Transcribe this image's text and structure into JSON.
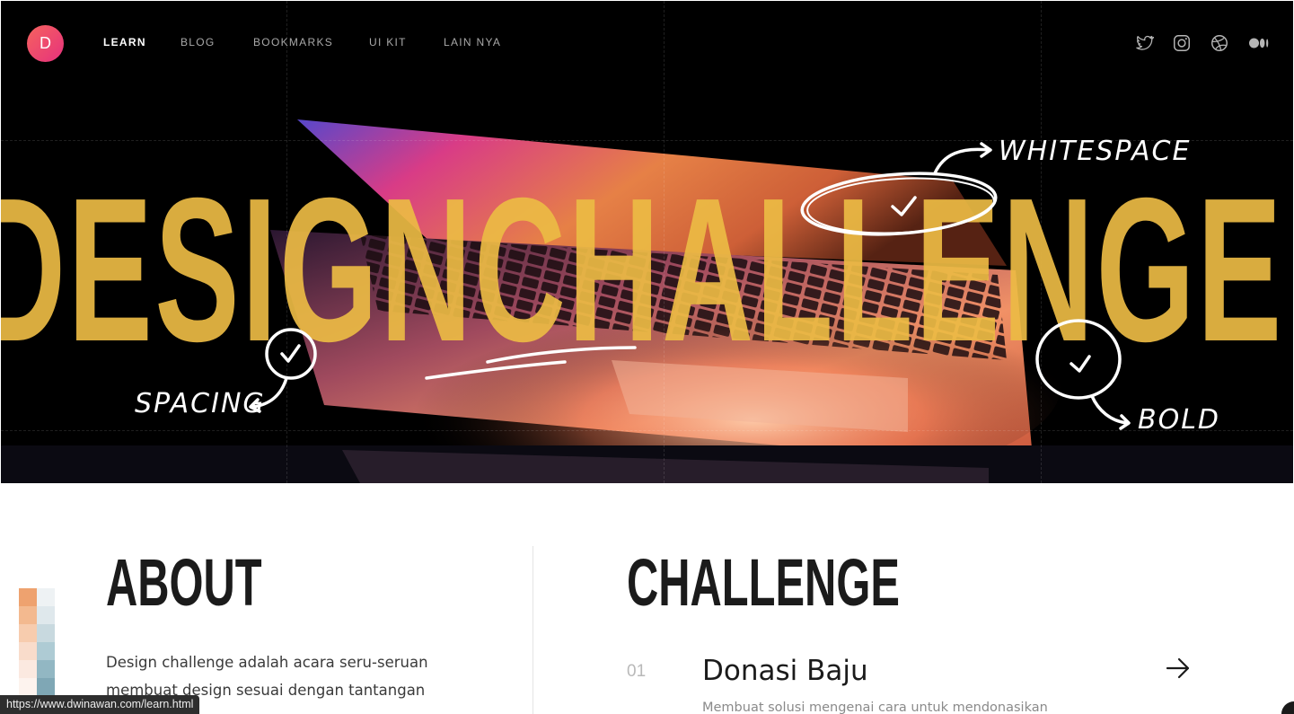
{
  "nav": {
    "logo_letter": "D",
    "links": [
      {
        "label": "LEARN",
        "active": true
      },
      {
        "label": "BLOG",
        "active": false
      },
      {
        "label": "BOOKMARKS",
        "active": false
      },
      {
        "label": "UI KIT",
        "active": false
      },
      {
        "label": "LAIN NYA",
        "active": false
      }
    ],
    "social_icons": [
      "twitter-icon",
      "instagram-icon",
      "dribbble-icon",
      "medium-icon"
    ]
  },
  "hero": {
    "title": "DESIGNCHALLENGE",
    "title_color": "#ecbb44",
    "annotations": {
      "whitespace": "WHITESPACE",
      "spacing": "SPACING",
      "bold": "BOLD"
    }
  },
  "about": {
    "title": "ABOUT",
    "text_line1": "Design challenge adalah acara seru-seruan",
    "text_line2": "membuat design sesuai dengan tantangan"
  },
  "challenge": {
    "title": "CHALLENGE",
    "items": [
      {
        "number": "01",
        "title": "Donasi Baju",
        "description": "Membuat solusi mengenai cara untuk mendonasikan"
      }
    ]
  },
  "status_bar": {
    "url": "https://www.dwinawan.com/learn.html"
  },
  "colors": {
    "logo_gradient_start": "#f6635e",
    "logo_gradient_end": "#e6317d",
    "hero_background": "#000000",
    "swatch_warm": [
      "#eea26f",
      "#f3b98f",
      "#f7ccae",
      "#f9dccb",
      "#fbe9e0",
      "#fdf3ee"
    ],
    "swatch_cool": [
      "#eef2f4",
      "#dfe8ec",
      "#c8d9df",
      "#aecbd4",
      "#92b7c3",
      "#7fa7b5"
    ]
  }
}
